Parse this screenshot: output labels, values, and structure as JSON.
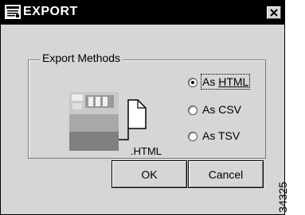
{
  "window": {
    "title": "EXPORT",
    "icon": "export-icon",
    "close_icon": "close-icon"
  },
  "export_methods": {
    "legend": "Export Methods",
    "illustration_label": ".HTML",
    "options": [
      {
        "label_pre": "As ",
        "label_underlined": "HTML",
        "checked": true
      },
      {
        "label": "As CSV",
        "checked": false
      },
      {
        "label": "As TSV",
        "checked": false
      }
    ]
  },
  "buttons": {
    "ok": "OK",
    "cancel": "Cancel"
  },
  "figure_id": "34325",
  "colors": {
    "titlebar": "#000000",
    "dialog_bg": "#d6d6d6"
  }
}
